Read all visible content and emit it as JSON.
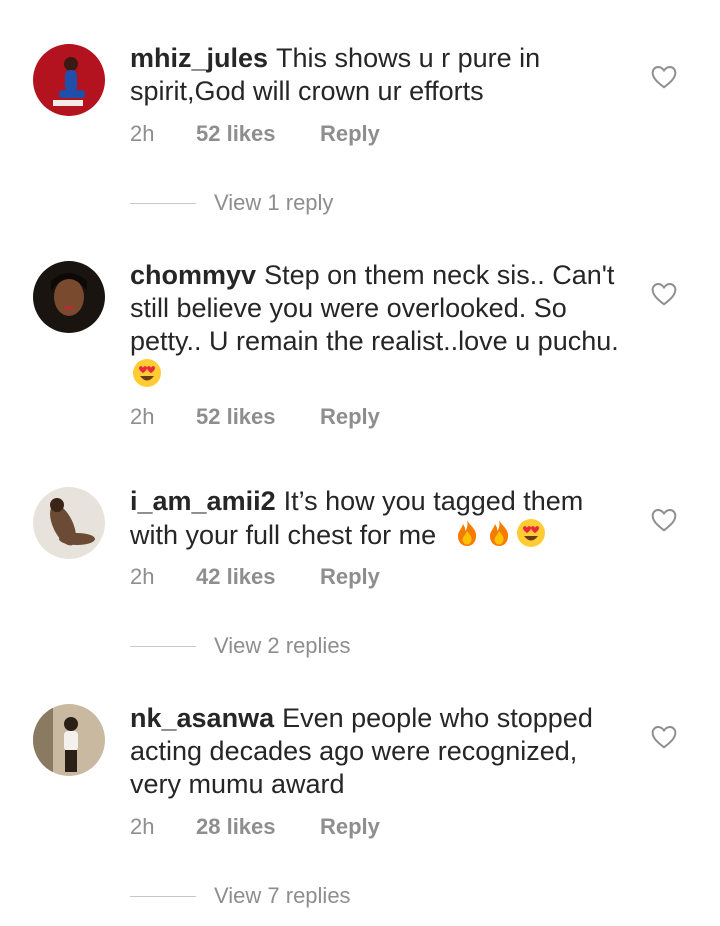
{
  "comments": [
    {
      "username": "mhiz_jules",
      "text": "This shows u r pure in spirit,God will crown ur efforts",
      "emojis": [],
      "time": "2h",
      "likes": "52 likes",
      "reply": "Reply",
      "view_replies": "View 1 reply",
      "avatar_colors": [
        "#b3121f",
        "#1f4fa8"
      ]
    },
    {
      "username": "chommyv",
      "text": "Step on them neck sis.. Can't still believe you were overlooked. So petty.. U remain the realist..love u puchu.",
      "emojis": [
        "heart-eyes-emoji-icon"
      ],
      "time": "2h",
      "likes": "52 likes",
      "reply": "Reply",
      "view_replies": "",
      "avatar_colors": [
        "#1a1410",
        "#7a4a2e"
      ]
    },
    {
      "username": "i_am_amii2",
      "text": "It’s how  you tagged them with your full chest for me",
      "emojis": [
        "fire-emoji-icon",
        "fire-emoji-icon",
        "heart-eyes-emoji-icon"
      ],
      "time": "2h",
      "likes": "42 likes",
      "reply": "Reply",
      "view_replies": "View 2 replies",
      "avatar_colors": [
        "#e8e2dc",
        "#6b4a36"
      ]
    },
    {
      "username": "nk_asanwa",
      "text": "Even people who stopped acting decades ago were recognized, very mumu award",
      "emojis": [],
      "time": "2h",
      "likes": "28 likes",
      "reply": "Reply",
      "view_replies": "View 7 replies",
      "avatar_colors": [
        "#c9b9a0",
        "#2a2018"
      ]
    }
  ],
  "colors": {
    "text": "#262626",
    "muted": "#8e8e8e",
    "divider": "#c7c7c7"
  }
}
